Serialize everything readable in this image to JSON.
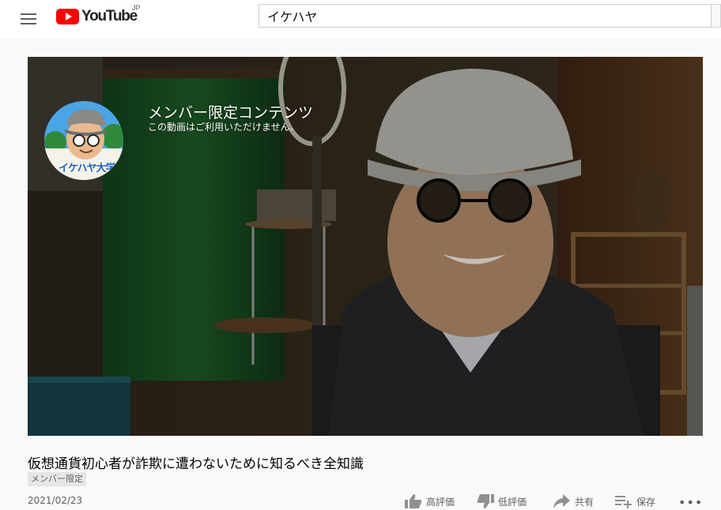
{
  "header": {
    "logo_text": "YouTube",
    "logo_region": "JP",
    "search_query": "イケハヤ"
  },
  "player": {
    "channel_avatar_text": "イケハヤ大学",
    "overlay_title": "メンバー限定コンテンツ",
    "overlay_subtitle": "この動画はご利用いただけません。"
  },
  "video": {
    "title": "仮想通貨初心者が詐欺に遭わないために知るべき全知識",
    "badge": "メンバー限定",
    "date": "2021/02/23"
  },
  "actions": {
    "like_label": "高評価",
    "dislike_label": "低評価",
    "share_label": "共有",
    "save_label": "保存"
  },
  "colors": {
    "brand": "#ff0000",
    "badge_bg": "#e6e6e6",
    "page_bg": "#f9f9f9"
  },
  "icons": [
    "menu-icon",
    "youtube-logo",
    "thumbs-up-icon",
    "thumbs-down-icon",
    "share-icon",
    "save-playlist-icon",
    "more-icon"
  ]
}
